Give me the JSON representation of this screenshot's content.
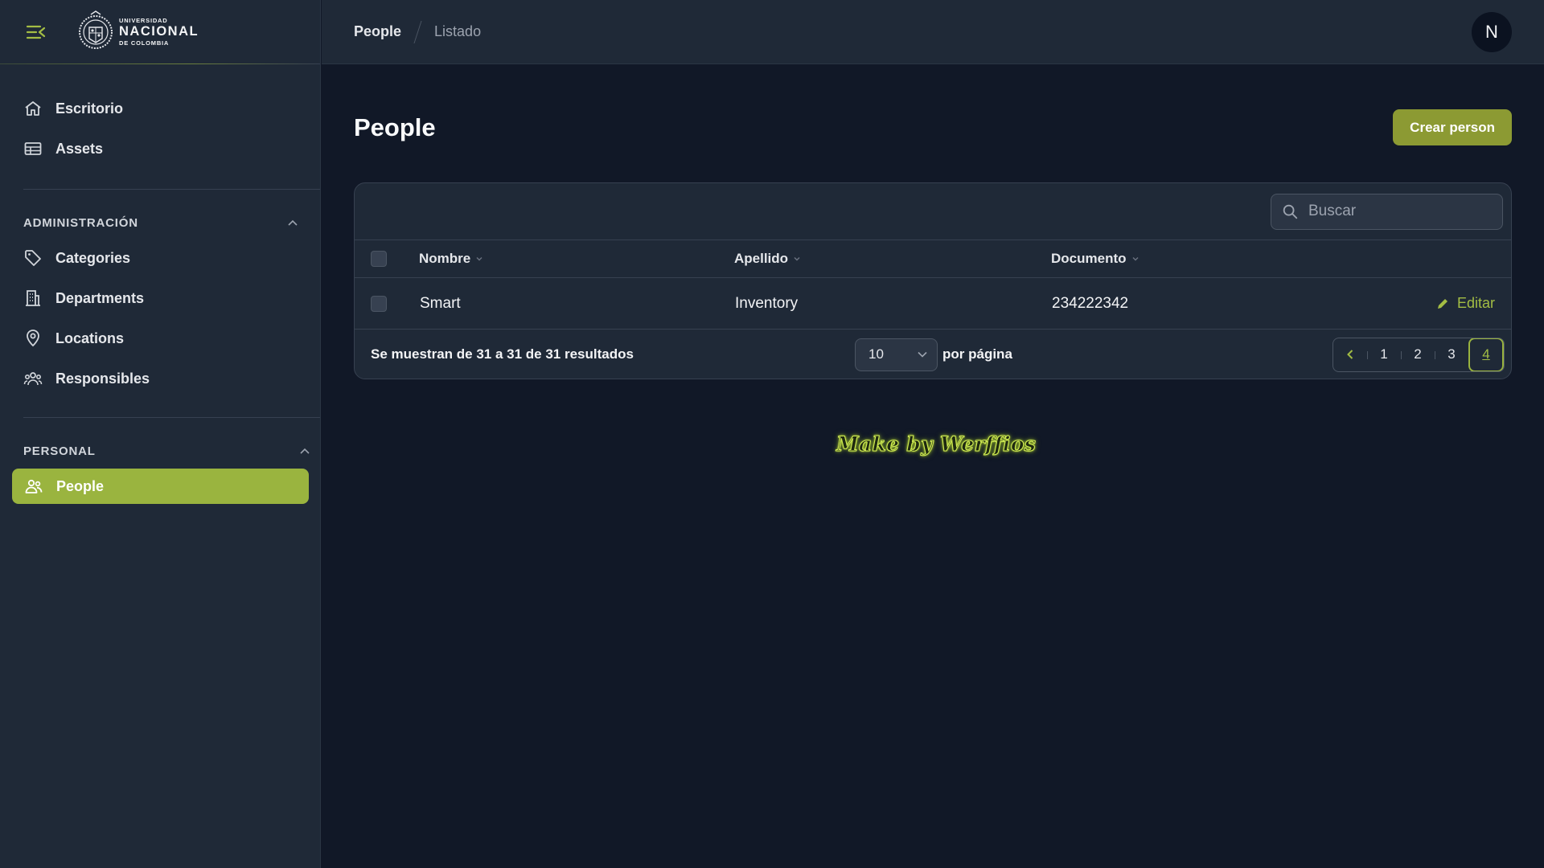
{
  "brand": {
    "line1": "UNIVERSIDAD",
    "line2": "NACIONAL",
    "line3": "DE COLOMBIA",
    "accent": "#9ab43f"
  },
  "sidebar": {
    "top_items": [
      {
        "label": "Escritorio",
        "icon": "home-icon"
      },
      {
        "label": "Assets",
        "icon": "table-icon"
      }
    ],
    "sections": [
      {
        "title": "ADMINISTRACIÓN",
        "items": [
          {
            "label": "Categories",
            "icon": "tag-icon"
          },
          {
            "label": "Departments",
            "icon": "building-icon"
          },
          {
            "label": "Locations",
            "icon": "map-pin-icon"
          },
          {
            "label": "Responsibles",
            "icon": "user-group-icon"
          }
        ]
      },
      {
        "title": "PERSONAL",
        "items": [
          {
            "label": "People",
            "icon": "users-icon",
            "active": true
          }
        ]
      }
    ]
  },
  "topbar": {
    "breadcrumb": [
      "People",
      "Listado"
    ],
    "avatar_initial": "N"
  },
  "page": {
    "title": "People",
    "create_button": "Crear person"
  },
  "table": {
    "search_placeholder": "Buscar",
    "columns": [
      "Nombre",
      "Apellido",
      "Documento"
    ],
    "rows": [
      {
        "nombre": "Smart",
        "apellido": "Inventory",
        "documento": "234222342",
        "action": "Editar"
      }
    ],
    "results_text": "Se muestran de 31 a 31 de 31 resultados",
    "per_page_value": "10",
    "per_page_label": "por página",
    "pages": [
      "1",
      "2",
      "3",
      "4"
    ],
    "current_page": "4"
  },
  "footer_credit": "Make by Werffios"
}
